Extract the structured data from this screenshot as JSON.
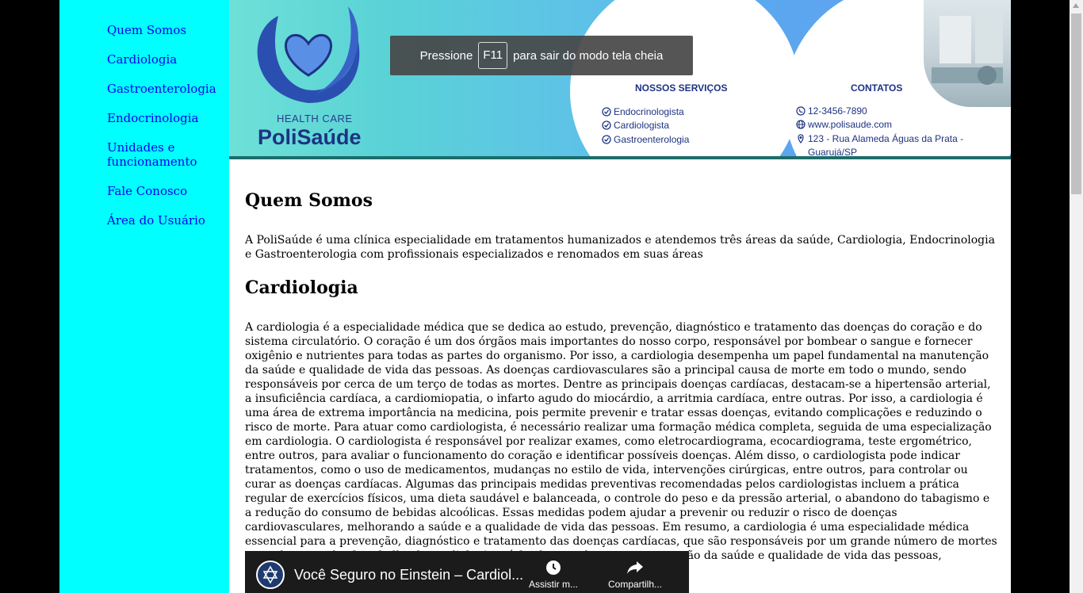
{
  "sidebar": {
    "items": [
      {
        "label": "Quem Somos"
      },
      {
        "label": "Cardiologia"
      },
      {
        "label": "Gastroenterologia"
      },
      {
        "label": "Endocrinologia"
      },
      {
        "label": "Unidades e funcionamento"
      },
      {
        "label": "Fale Conosco"
      },
      {
        "label": "Área do Usuário"
      }
    ]
  },
  "banner": {
    "brand_sub": "HEALTH CARE",
    "brand_name": "PoliSaúde",
    "services_title": "NOSSOS SERVIÇOS",
    "services": [
      "Endocrinologista",
      "Cardiologista",
      "Gastroenterologia"
    ],
    "contacts_title": "CONTATOS",
    "contacts": [
      "12-3456-7890",
      "www.polisaude.com",
      "123 - Rua Alameda Águas da Prata -",
      "Guarujá/SP"
    ]
  },
  "fullscreen_notice": {
    "before": "Pressione",
    "key": "F11",
    "after": "para sair do modo tela cheia"
  },
  "main": {
    "sections": [
      {
        "heading": "Quem Somos",
        "text": "A PoliSaúde é uma clínica especialidade em tratamentos humanizados e atendemos três áreas da saúde, Cardiologia, Endocrinologia e Gastroenterologia com profissionais especializados e renomados em suas áreas"
      },
      {
        "heading": "Cardiologia",
        "text": "A cardiologia é a especialidade médica que se dedica ao estudo, prevenção, diagnóstico e tratamento das doenças do coração e do sistema circulatório. O coração é um dos órgãos mais importantes do nosso corpo, responsável por bombear o sangue e fornecer oxigênio e nutrientes para todas as partes do organismo. Por isso, a cardiologia desempenha um papel fundamental na manutenção da saúde e qualidade de vida das pessoas. As doenças cardiovasculares são a principal causa de morte em todo o mundo, sendo responsáveis por cerca de um terço de todas as mortes. Dentre as principais doenças cardíacas, destacam-se a hipertensão arterial, a insuficiência cardíaca, a cardiomiopatia, o infarto agudo do miocárdio, a arritmia cardíaca, entre outras. Por isso, a cardiologia é uma área de extrema importância na medicina, pois permite prevenir e tratar essas doenças, evitando complicações e reduzindo o risco de morte. Para atuar como cardiologista, é necessário realizar uma formação médica completa, seguida de uma especialização em cardiologia. O cardiologista é responsável por realizar exames, como eletrocardiograma, ecocardiograma, teste ergométrico, entre outros, para avaliar o funcionamento do coração e identificar possíveis doenças. Além disso, o cardiologista pode indicar tratamentos, como o uso de medicamentos, mudanças no estilo de vida, intervenções cirúrgicas, entre outros, para controlar ou curar as doenças cardíacas. Algumas das principais medidas preventivas recomendadas pelos cardiologistas incluem a prática regular de exercícios físicos, uma dieta saudável e balanceada, o controle do peso e da pressão arterial, o abandono do tabagismo e a redução do consumo de bebidas alcoólicas. Essas medidas podem ajudar a prevenir ou reduzir o risco de doenças cardiovasculares, melhorando a saúde e a qualidade de vida das pessoas. Em resumo, a cardiologia é uma especialidade médica essencial para a prevenção, diagnóstico e tratamento das doenças cardíacas, que são responsáveis por um grande número de mortes em todo o mundo. O trabalho do cardiologista é fundamental para a manutenção da saúde e qualidade de vida das pessoas, permitindo que elas possam viver com bem-estar e plenitude"
      }
    ],
    "video": {
      "title": "Você Seguro no Einstein – Cardiol...",
      "watch_later": "Assistir m...",
      "share": "Compartilh..."
    }
  },
  "colors": {
    "sidebar_bg": "#00ffff",
    "link": "#0000ee",
    "banner_border": "#1c6c6a",
    "brand": "#1d3383"
  }
}
